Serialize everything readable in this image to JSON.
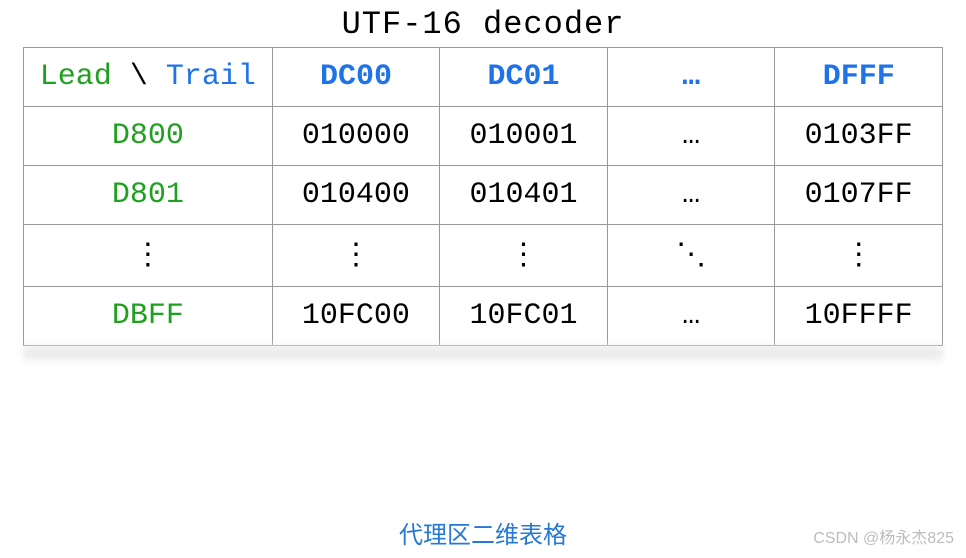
{
  "title": "UTF-16 decoder",
  "corner": {
    "lead": "Lead",
    "slash": " \\ ",
    "trail": "Trail"
  },
  "col_headers": [
    "DC00",
    "DC01",
    "…",
    "DFFF"
  ],
  "rows": [
    {
      "head": "D800",
      "cells": [
        "010000",
        "010001",
        "…",
        "0103FF"
      ]
    },
    {
      "head": "D801",
      "cells": [
        "010400",
        "010401",
        "…",
        "0107FF"
      ]
    },
    {
      "head": "⋮",
      "cells": [
        "⋮",
        "⋮",
        "⋱",
        "⋮"
      ]
    },
    {
      "head": "DBFF",
      "cells": [
        "10FC00",
        "10FC01",
        "…",
        "10FFFF"
      ]
    }
  ],
  "caption": "代理区二维表格",
  "watermark": "CSDN @杨永杰825"
}
